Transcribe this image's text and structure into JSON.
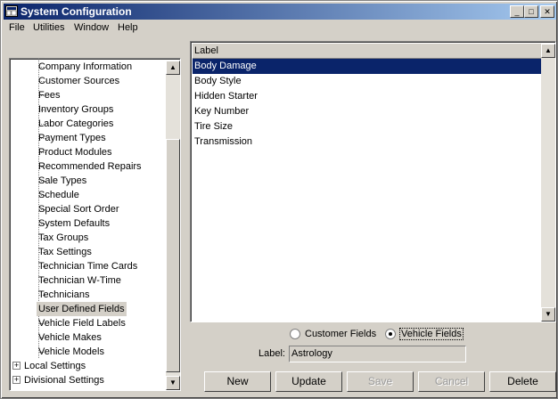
{
  "window": {
    "title": "System Configuration",
    "minimize_glyph": "_",
    "maximize_glyph": "□",
    "close_glyph": "✕"
  },
  "menu": {
    "file": "File",
    "utilities": "Utilities",
    "window": "Window",
    "help": "Help"
  },
  "tree": {
    "items": [
      {
        "label": "Company Information"
      },
      {
        "label": "Customer Sources"
      },
      {
        "label": "Fees"
      },
      {
        "label": "Inventory Groups"
      },
      {
        "label": "Labor Categories"
      },
      {
        "label": "Payment Types"
      },
      {
        "label": "Product Modules"
      },
      {
        "label": "Recommended Repairs"
      },
      {
        "label": "Sale Types"
      },
      {
        "label": "Schedule"
      },
      {
        "label": "Special Sort Order"
      },
      {
        "label": "System Defaults"
      },
      {
        "label": "Tax Groups"
      },
      {
        "label": "Tax Settings"
      },
      {
        "label": "Technician Time Cards"
      },
      {
        "label": "Technician W-Time"
      },
      {
        "label": "Technicians"
      },
      {
        "label": "User Defined Fields",
        "selected": true
      },
      {
        "label": "Vehicle Field Labels"
      },
      {
        "label": "Vehicle Makes"
      },
      {
        "label": "Vehicle Models"
      }
    ],
    "roots": [
      {
        "label": "Local Settings",
        "expander": "+"
      },
      {
        "label": "Divisional Settings",
        "expander": "+"
      }
    ]
  },
  "list": {
    "column_header": "Label",
    "rows": [
      "Body Damage",
      "Body Style",
      "Hidden Starter",
      "Key Number",
      "Tire Size",
      "Transmission"
    ],
    "selected_row": 0
  },
  "radios": {
    "customer_fields": "Customer Fields",
    "vehicle_fields": "Vehicle Fields",
    "selected": "vehicle_fields"
  },
  "label_field": {
    "caption": "Label:",
    "value": "Astrology"
  },
  "buttons": {
    "new": "New",
    "update": "Update",
    "save": "Save",
    "cancel": "Cancel",
    "delete": "Delete"
  },
  "colors": {
    "titlebar_start": "#0a246a",
    "titlebar_end": "#a6caf0",
    "selection": "#0a246a",
    "face": "#d4d0c8"
  }
}
